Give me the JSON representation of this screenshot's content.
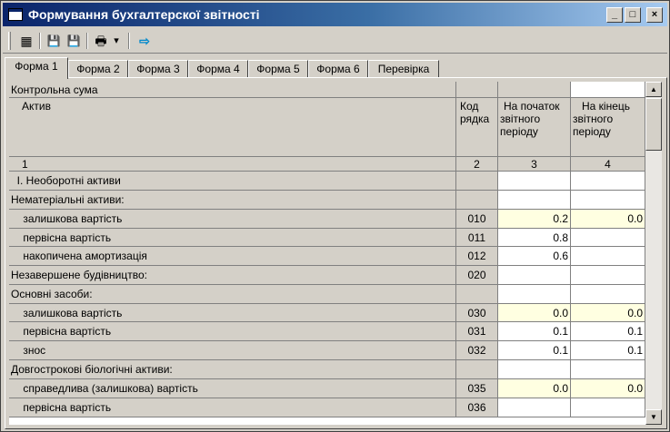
{
  "window": {
    "title": "Формування бухгалтерскої звітності",
    "min_label": "_",
    "max_label": "□",
    "close_label": "×"
  },
  "toolbar": {
    "calc_icon": "▦",
    "save_icon": "💾",
    "save_as_icon": "💾",
    "print_icon": "🖶",
    "dropdown_icon": "▾",
    "go_icon": "⇨"
  },
  "tabs": [
    "Форма 1",
    "Форма 2",
    "Форма 3",
    "Форма 4",
    "Форма 5",
    "Форма 6",
    "Перевірка"
  ],
  "table": {
    "checksum_label": "Контрольна сума",
    "headers": {
      "asset": "Актив",
      "code": "Код рядка",
      "begin": "На початок звітного періоду",
      "end": "На кінець звітного періоду"
    },
    "col_numbers": [
      "1",
      "2",
      "3",
      "4"
    ],
    "rows": [
      {
        "label": "  І. Необоротні активи",
        "code": "",
        "begin": "",
        "end": ""
      },
      {
        "label": "Нематеріальні активи:",
        "code": "",
        "begin": "",
        "end": ""
      },
      {
        "label": "    залишкова вартість",
        "code": "010",
        "begin": "0.2",
        "end": "0.0"
      },
      {
        "label": "    первісна вартість",
        "code": "011",
        "begin": "0.8",
        "end": ""
      },
      {
        "label": "    накопичена амортизація",
        "code": "012",
        "begin": "0.6",
        "end": ""
      },
      {
        "label": "Незавершене будівництво:",
        "code": "020",
        "begin": "",
        "end": ""
      },
      {
        "label": "Основні засоби:",
        "code": "",
        "begin": "",
        "end": ""
      },
      {
        "label": "    залишкова вартість",
        "code": "030",
        "begin": "0.0",
        "end": "0.0"
      },
      {
        "label": "    первісна вартість",
        "code": "031",
        "begin": "0.1",
        "end": "0.1"
      },
      {
        "label": "    знос",
        "code": "032",
        "begin": "0.1",
        "end": "0.1"
      },
      {
        "label": "Довгострокові біологічні активи:",
        "code": "",
        "begin": "",
        "end": ""
      },
      {
        "label": "    справедлива (залишкова) вартість",
        "code": "035",
        "begin": "0.0",
        "end": "0.0"
      },
      {
        "label": "    первісна вартість",
        "code": "036",
        "begin": "",
        "end": ""
      }
    ]
  },
  "scrollbar": {
    "up_label": "▲",
    "down_label": "▼"
  }
}
